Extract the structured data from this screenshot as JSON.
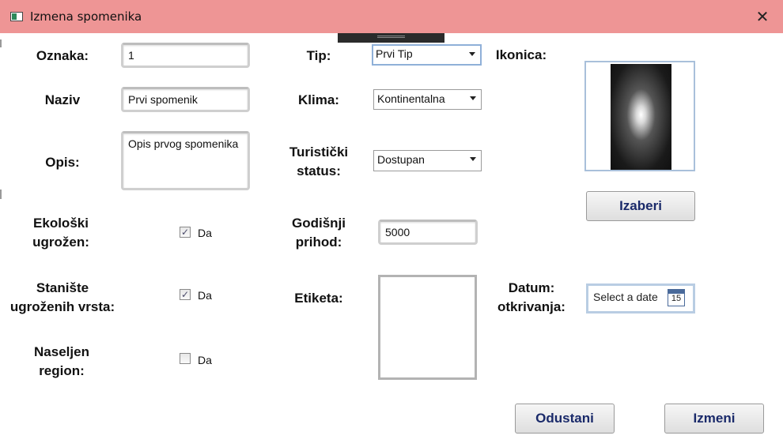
{
  "window": {
    "title": "Izmena spomenika",
    "close_symbol": "✕"
  },
  "form": {
    "oznaka": {
      "label": "Oznaka:",
      "value": "1"
    },
    "naziv": {
      "label": "Naziv",
      "value": "Prvi spomenik"
    },
    "opis": {
      "label": "Opis:",
      "value": "Opis prvog spomenika"
    },
    "ekoloski": {
      "label": "Ekološki ugrožen:",
      "checked": true,
      "check_label": "Da"
    },
    "staniste": {
      "label": "Stanište ugroženih vrsta:",
      "checked": true,
      "check_label": "Da"
    },
    "naseljen": {
      "label": "Naseljen region:",
      "checked": false,
      "check_label": "Da"
    },
    "tip": {
      "label": "Tip:",
      "value": "Prvi Tip"
    },
    "klima": {
      "label": "Klima:",
      "value": "Kontinentalna"
    },
    "turisticki": {
      "label": "Turistički status:",
      "value": "Dostupan"
    },
    "prihod": {
      "label": "Godišnji prihod:",
      "value": "5000"
    },
    "etiketa": {
      "label": "Etiketa:"
    },
    "ikonica": {
      "label": "Ikonica:",
      "button": "Izaberi"
    },
    "datum": {
      "label": "Datum: otkrivanja:",
      "placeholder": "Select a date",
      "calendar_day": "15"
    }
  },
  "buttons": {
    "cancel": "Odustani",
    "submit": "Izmeni"
  },
  "colors": {
    "titlebar": "#ee9595",
    "button_text": "#1a2a6a",
    "focus_border": "#8fb0d8"
  },
  "icons": [
    "app-window-icon",
    "close-icon",
    "checkbox-checked-icon",
    "calendar-icon",
    "dropdown-arrow-icon"
  ]
}
